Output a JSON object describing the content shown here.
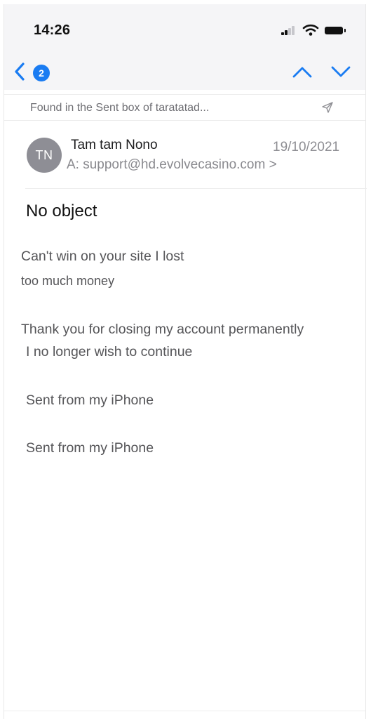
{
  "status_bar": {
    "time": "14:26",
    "icons": [
      "cellular-signal-icon",
      "wifi-icon",
      "battery-icon"
    ]
  },
  "nav": {
    "back_icon": "chevron-left-icon",
    "unread_count": "2",
    "prev_icon": "chevron-up-icon",
    "next_icon": "chevron-down-icon"
  },
  "found_bar": {
    "text": "Found in the Sent box of taratatad...",
    "icon": "paper-plane-icon"
  },
  "message": {
    "avatar_initials": "TN",
    "sender": "Tam tam Nono",
    "date": "19/10/2021",
    "recipient": "A: support@hd.evolvecasino.com >",
    "subject": "No object",
    "body": [
      "Can't win on your site I lost",
      "too much money",
      "Thank you for closing my account permanently",
      "I no longer wish to continue",
      "Sent from my iPhone",
      "Sent from my iPhone"
    ]
  },
  "colors": {
    "accent": "#1a7cf2",
    "top_background": "#f5f5f7",
    "avatar": "#8e8e95"
  }
}
